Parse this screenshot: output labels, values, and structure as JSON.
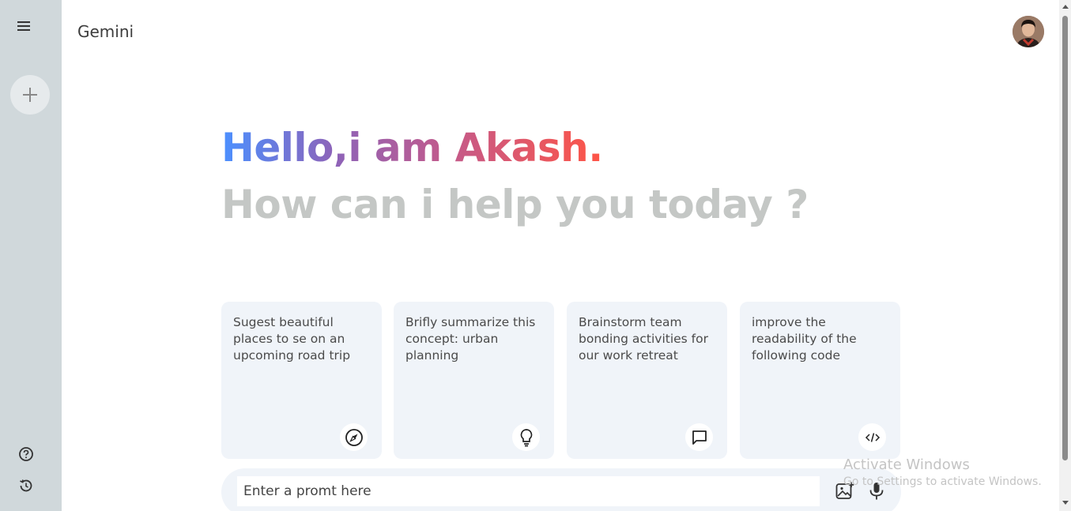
{
  "app": {
    "title": "Gemini"
  },
  "sidebar": {
    "menu_icon": "hamburger-menu-icon",
    "new_chat_icon": "plus-icon",
    "bottom_icons": [
      "help-icon",
      "history-icon"
    ]
  },
  "greeting": {
    "hello": "Hello,i am Akash.",
    "sub": "How can i help you today ?",
    "gradient_colors": [
      "#4b90ff",
      "#8e63b8",
      "#c45a8a",
      "#ff5546"
    ]
  },
  "cards": [
    {
      "text": "Sugest beautiful places to se on an upcoming road trip",
      "icon": "compass-icon"
    },
    {
      "text": "Brifly summarize this concept: urban planning",
      "icon": "lightbulb-icon"
    },
    {
      "text": "Brainstorm team bonding activities for our work retreat",
      "icon": "message-icon"
    },
    {
      "text": "improve the readability of the following code",
      "icon": "code-icon"
    }
  ],
  "prompt": {
    "placeholder": "Enter a promt here",
    "icons": [
      "gallery-icon",
      "microphone-icon"
    ]
  },
  "watermark": {
    "line1": "Activate Windows",
    "line2": "Go to Settings to activate Windows."
  },
  "colors": {
    "sidebar_bg": "#d0d8db",
    "card_bg": "#f0f4f9",
    "subtext": "#c4c7c5"
  }
}
